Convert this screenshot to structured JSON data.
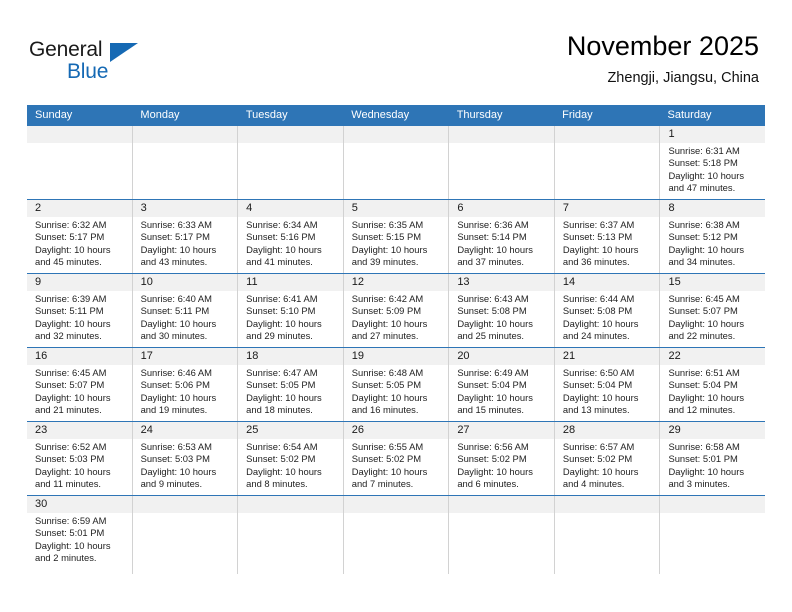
{
  "brand": {
    "name_top": "General",
    "name_bottom": "Blue",
    "triangle_color": "#1569b4"
  },
  "header": {
    "title": "November 2025",
    "location": "Zhengji, Jiangsu, China",
    "accent_color": "#2e75b6",
    "daynum_band_color": "#f1f1f1"
  },
  "calendar": {
    "weekday_headers": [
      "Sunday",
      "Monday",
      "Tuesday",
      "Wednesday",
      "Thursday",
      "Friday",
      "Saturday"
    ],
    "weeks": [
      [
        {
          "day": "",
          "sunrise": "",
          "sunset": "",
          "daylight1": "",
          "daylight2": ""
        },
        {
          "day": "",
          "sunrise": "",
          "sunset": "",
          "daylight1": "",
          "daylight2": ""
        },
        {
          "day": "",
          "sunrise": "",
          "sunset": "",
          "daylight1": "",
          "daylight2": ""
        },
        {
          "day": "",
          "sunrise": "",
          "sunset": "",
          "daylight1": "",
          "daylight2": ""
        },
        {
          "day": "",
          "sunrise": "",
          "sunset": "",
          "daylight1": "",
          "daylight2": ""
        },
        {
          "day": "",
          "sunrise": "",
          "sunset": "",
          "daylight1": "",
          "daylight2": ""
        },
        {
          "day": "1",
          "sunrise": "Sunrise: 6:31 AM",
          "sunset": "Sunset: 5:18 PM",
          "daylight1": "Daylight: 10 hours",
          "daylight2": "and 47 minutes."
        }
      ],
      [
        {
          "day": "2",
          "sunrise": "Sunrise: 6:32 AM",
          "sunset": "Sunset: 5:17 PM",
          "daylight1": "Daylight: 10 hours",
          "daylight2": "and 45 minutes."
        },
        {
          "day": "3",
          "sunrise": "Sunrise: 6:33 AM",
          "sunset": "Sunset: 5:17 PM",
          "daylight1": "Daylight: 10 hours",
          "daylight2": "and 43 minutes."
        },
        {
          "day": "4",
          "sunrise": "Sunrise: 6:34 AM",
          "sunset": "Sunset: 5:16 PM",
          "daylight1": "Daylight: 10 hours",
          "daylight2": "and 41 minutes."
        },
        {
          "day": "5",
          "sunrise": "Sunrise: 6:35 AM",
          "sunset": "Sunset: 5:15 PM",
          "daylight1": "Daylight: 10 hours",
          "daylight2": "and 39 minutes."
        },
        {
          "day": "6",
          "sunrise": "Sunrise: 6:36 AM",
          "sunset": "Sunset: 5:14 PM",
          "daylight1": "Daylight: 10 hours",
          "daylight2": "and 37 minutes."
        },
        {
          "day": "7",
          "sunrise": "Sunrise: 6:37 AM",
          "sunset": "Sunset: 5:13 PM",
          "daylight1": "Daylight: 10 hours",
          "daylight2": "and 36 minutes."
        },
        {
          "day": "8",
          "sunrise": "Sunrise: 6:38 AM",
          "sunset": "Sunset: 5:12 PM",
          "daylight1": "Daylight: 10 hours",
          "daylight2": "and 34 minutes."
        }
      ],
      [
        {
          "day": "9",
          "sunrise": "Sunrise: 6:39 AM",
          "sunset": "Sunset: 5:11 PM",
          "daylight1": "Daylight: 10 hours",
          "daylight2": "and 32 minutes."
        },
        {
          "day": "10",
          "sunrise": "Sunrise: 6:40 AM",
          "sunset": "Sunset: 5:11 PM",
          "daylight1": "Daylight: 10 hours",
          "daylight2": "and 30 minutes."
        },
        {
          "day": "11",
          "sunrise": "Sunrise: 6:41 AM",
          "sunset": "Sunset: 5:10 PM",
          "daylight1": "Daylight: 10 hours",
          "daylight2": "and 29 minutes."
        },
        {
          "day": "12",
          "sunrise": "Sunrise: 6:42 AM",
          "sunset": "Sunset: 5:09 PM",
          "daylight1": "Daylight: 10 hours",
          "daylight2": "and 27 minutes."
        },
        {
          "day": "13",
          "sunrise": "Sunrise: 6:43 AM",
          "sunset": "Sunset: 5:08 PM",
          "daylight1": "Daylight: 10 hours",
          "daylight2": "and 25 minutes."
        },
        {
          "day": "14",
          "sunrise": "Sunrise: 6:44 AM",
          "sunset": "Sunset: 5:08 PM",
          "daylight1": "Daylight: 10 hours",
          "daylight2": "and 24 minutes."
        },
        {
          "day": "15",
          "sunrise": "Sunrise: 6:45 AM",
          "sunset": "Sunset: 5:07 PM",
          "daylight1": "Daylight: 10 hours",
          "daylight2": "and 22 minutes."
        }
      ],
      [
        {
          "day": "16",
          "sunrise": "Sunrise: 6:45 AM",
          "sunset": "Sunset: 5:07 PM",
          "daylight1": "Daylight: 10 hours",
          "daylight2": "and 21 minutes."
        },
        {
          "day": "17",
          "sunrise": "Sunrise: 6:46 AM",
          "sunset": "Sunset: 5:06 PM",
          "daylight1": "Daylight: 10 hours",
          "daylight2": "and 19 minutes."
        },
        {
          "day": "18",
          "sunrise": "Sunrise: 6:47 AM",
          "sunset": "Sunset: 5:05 PM",
          "daylight1": "Daylight: 10 hours",
          "daylight2": "and 18 minutes."
        },
        {
          "day": "19",
          "sunrise": "Sunrise: 6:48 AM",
          "sunset": "Sunset: 5:05 PM",
          "daylight1": "Daylight: 10 hours",
          "daylight2": "and 16 minutes."
        },
        {
          "day": "20",
          "sunrise": "Sunrise: 6:49 AM",
          "sunset": "Sunset: 5:04 PM",
          "daylight1": "Daylight: 10 hours",
          "daylight2": "and 15 minutes."
        },
        {
          "day": "21",
          "sunrise": "Sunrise: 6:50 AM",
          "sunset": "Sunset: 5:04 PM",
          "daylight1": "Daylight: 10 hours",
          "daylight2": "and 13 minutes."
        },
        {
          "day": "22",
          "sunrise": "Sunrise: 6:51 AM",
          "sunset": "Sunset: 5:04 PM",
          "daylight1": "Daylight: 10 hours",
          "daylight2": "and 12 minutes."
        }
      ],
      [
        {
          "day": "23",
          "sunrise": "Sunrise: 6:52 AM",
          "sunset": "Sunset: 5:03 PM",
          "daylight1": "Daylight: 10 hours",
          "daylight2": "and 11 minutes."
        },
        {
          "day": "24",
          "sunrise": "Sunrise: 6:53 AM",
          "sunset": "Sunset: 5:03 PM",
          "daylight1": "Daylight: 10 hours",
          "daylight2": "and 9 minutes."
        },
        {
          "day": "25",
          "sunrise": "Sunrise: 6:54 AM",
          "sunset": "Sunset: 5:02 PM",
          "daylight1": "Daylight: 10 hours",
          "daylight2": "and 8 minutes."
        },
        {
          "day": "26",
          "sunrise": "Sunrise: 6:55 AM",
          "sunset": "Sunset: 5:02 PM",
          "daylight1": "Daylight: 10 hours",
          "daylight2": "and 7 minutes."
        },
        {
          "day": "27",
          "sunrise": "Sunrise: 6:56 AM",
          "sunset": "Sunset: 5:02 PM",
          "daylight1": "Daylight: 10 hours",
          "daylight2": "and 6 minutes."
        },
        {
          "day": "28",
          "sunrise": "Sunrise: 6:57 AM",
          "sunset": "Sunset: 5:02 PM",
          "daylight1": "Daylight: 10 hours",
          "daylight2": "and 4 minutes."
        },
        {
          "day": "29",
          "sunrise": "Sunrise: 6:58 AM",
          "sunset": "Sunset: 5:01 PM",
          "daylight1": "Daylight: 10 hours",
          "daylight2": "and 3 minutes."
        }
      ],
      [
        {
          "day": "30",
          "sunrise": "Sunrise: 6:59 AM",
          "sunset": "Sunset: 5:01 PM",
          "daylight1": "Daylight: 10 hours",
          "daylight2": "and 2 minutes."
        },
        {
          "day": "",
          "sunrise": "",
          "sunset": "",
          "daylight1": "",
          "daylight2": ""
        },
        {
          "day": "",
          "sunrise": "",
          "sunset": "",
          "daylight1": "",
          "daylight2": ""
        },
        {
          "day": "",
          "sunrise": "",
          "sunset": "",
          "daylight1": "",
          "daylight2": ""
        },
        {
          "day": "",
          "sunrise": "",
          "sunset": "",
          "daylight1": "",
          "daylight2": ""
        },
        {
          "day": "",
          "sunrise": "",
          "sunset": "",
          "daylight1": "",
          "daylight2": ""
        },
        {
          "day": "",
          "sunrise": "",
          "sunset": "",
          "daylight1": "",
          "daylight2": ""
        }
      ]
    ]
  }
}
